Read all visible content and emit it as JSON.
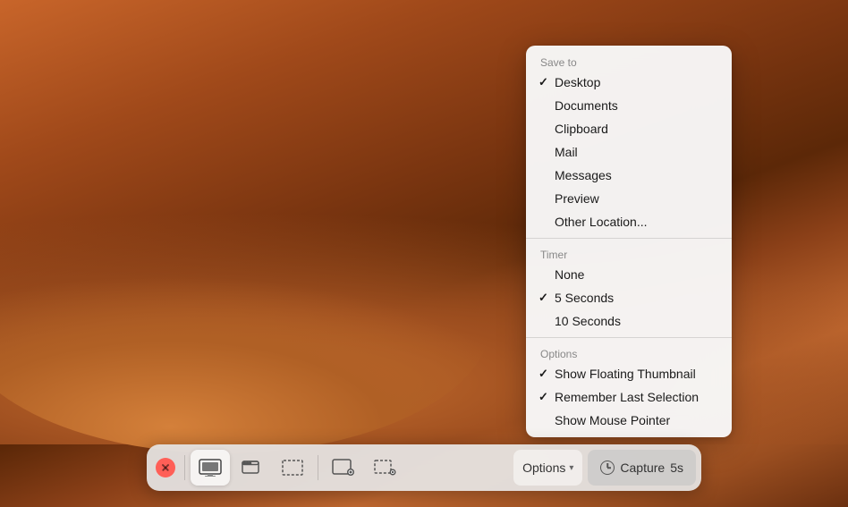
{
  "desktop": {
    "bg_color": "#8b4018"
  },
  "dropdown": {
    "save_to_label": "Save to",
    "items_save": [
      {
        "label": "Desktop",
        "checked": true
      },
      {
        "label": "Documents",
        "checked": false
      },
      {
        "label": "Clipboard",
        "checked": false
      },
      {
        "label": "Mail",
        "checked": false
      },
      {
        "label": "Messages",
        "checked": false
      },
      {
        "label": "Preview",
        "checked": false
      },
      {
        "label": "Other Location...",
        "checked": false
      }
    ],
    "timer_label": "Timer",
    "items_timer": [
      {
        "label": "None",
        "checked": false
      },
      {
        "label": "5 Seconds",
        "checked": true
      },
      {
        "label": "10 Seconds",
        "checked": false
      }
    ],
    "options_label": "Options",
    "items_options": [
      {
        "label": "Show Floating Thumbnail",
        "checked": true
      },
      {
        "label": "Remember Last Selection",
        "checked": true
      },
      {
        "label": "Show Mouse Pointer",
        "checked": false
      }
    ]
  },
  "toolbar": {
    "close_label": "×",
    "options_label": "Options",
    "capture_label": "Capture",
    "capture_timer": "5s",
    "buttons": [
      {
        "name": "capture-entire-screen",
        "title": "Capture Entire Screen"
      },
      {
        "name": "capture-window",
        "title": "Capture Selected Window"
      },
      {
        "name": "capture-selection",
        "title": "Capture Selected Portion"
      },
      {
        "name": "record-screen",
        "title": "Record Entire Screen"
      },
      {
        "name": "record-selection",
        "title": "Record Selected Portion"
      }
    ]
  }
}
